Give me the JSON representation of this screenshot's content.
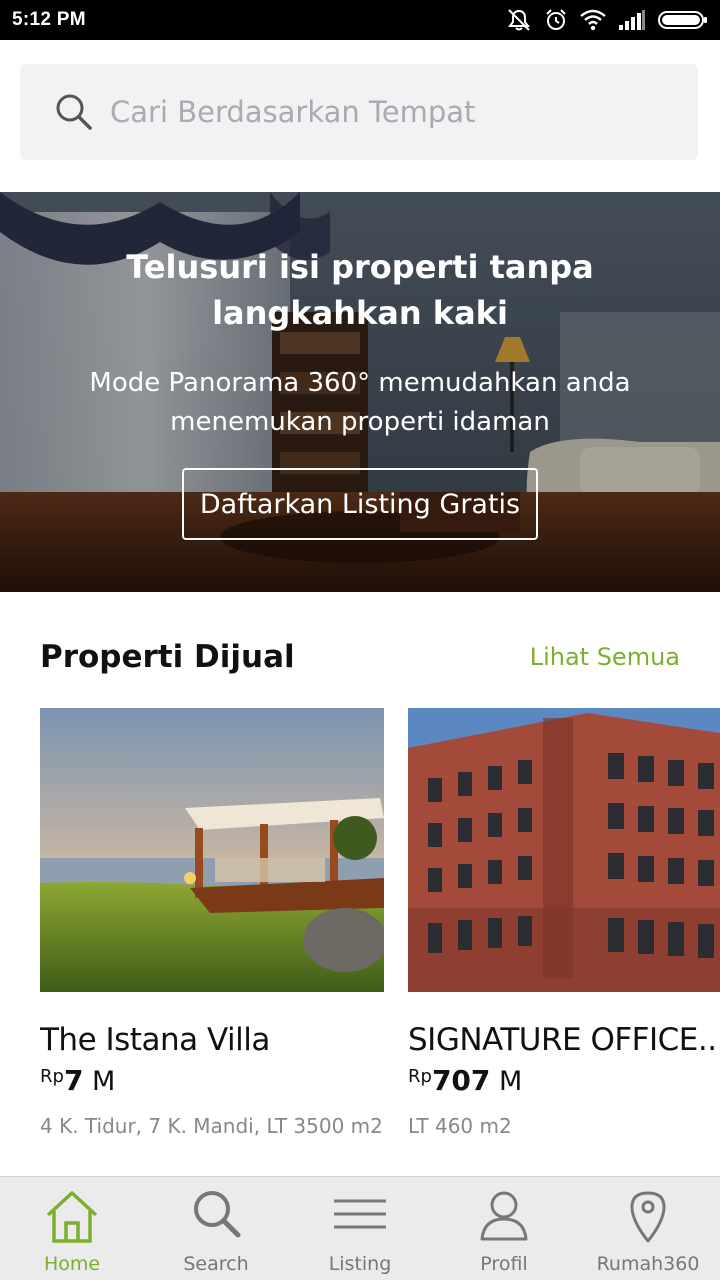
{
  "status_bar": {
    "time": "5:12 PM",
    "icons": [
      "mute-icon",
      "alarm-icon",
      "wifi-icon",
      "signal-icon",
      "battery-icon"
    ]
  },
  "search": {
    "placeholder": "Cari Berdasarkan Tempat",
    "icon": "search-icon"
  },
  "hero": {
    "title": "Telusuri isi properti tanpa langkahkan kaki",
    "subtitle": "Mode Panorama 360° memudahkan anda menemukan properti idaman",
    "button_label": "Daftarkan Listing Gratis"
  },
  "section": {
    "title": "Properti Dijual",
    "see_all": "Lihat Semua"
  },
  "listings": [
    {
      "title": "The Istana Villa",
      "currency": "Rp",
      "price": "7",
      "unit": " M",
      "details": "4 K. Tidur, 7 K. Mandi, LT 3500 m2"
    },
    {
      "title": "SIGNATURE OFFICE...",
      "currency": "Rp",
      "price": "707",
      "unit": " M",
      "details": "LT 460 m2"
    }
  ],
  "bottom_nav": [
    {
      "label": "Home",
      "icon": "home-icon",
      "active": true
    },
    {
      "label": "Search",
      "icon": "search-icon",
      "active": false
    },
    {
      "label": "Listing",
      "icon": "menu-icon",
      "active": false
    },
    {
      "label": "Profil",
      "icon": "user-icon",
      "active": false
    },
    {
      "label": "Rumah360",
      "icon": "location-pin-icon",
      "active": false
    }
  ],
  "colors": {
    "accent": "#7cb02c",
    "status_bar": "#000000",
    "nav_bg": "#ebebeb",
    "search_bg": "#f1f2f4"
  }
}
